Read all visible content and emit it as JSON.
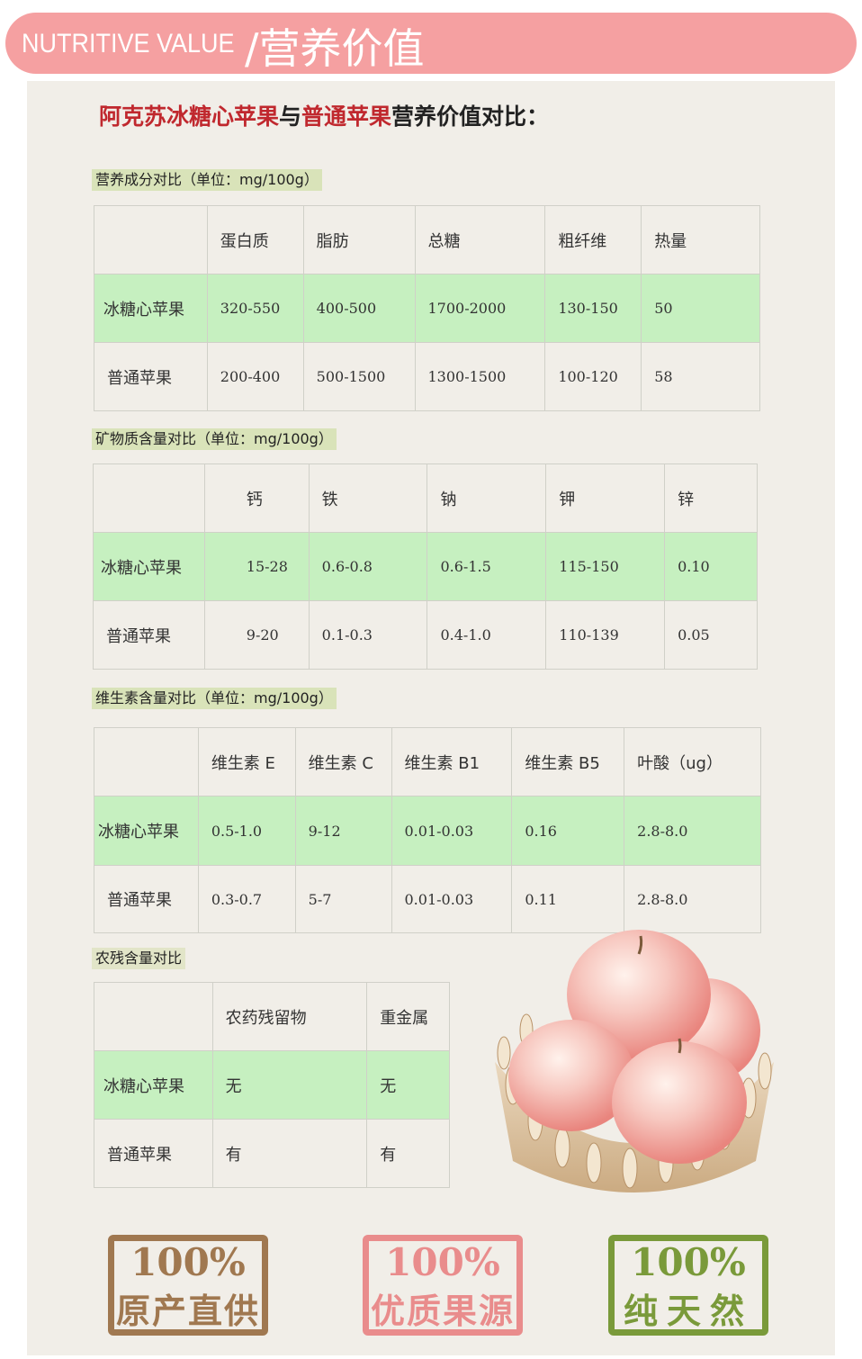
{
  "banner": {
    "en": "NUTRITIVE VALUE",
    "cn": "/营养价值"
  },
  "headline": {
    "part1": "阿克苏冰糖心苹果",
    "part2": "与",
    "part3": "普通苹果",
    "part4": "营养价值对比："
  },
  "colors": {
    "banner": "#f5a0a1",
    "highlight_row": "#c6f0c0",
    "label_bg": "#d9e3b9",
    "accent_red": "#c0282e"
  },
  "sections": [
    {
      "label": "营养成分对比（单位：mg/100g）",
      "headers": [
        "",
        "蛋白质",
        "脂肪",
        "总糖",
        "粗纤维",
        "热量"
      ],
      "rows": [
        [
          "冰糖心苹果",
          "320-550",
          "400-500",
          "1700-2000",
          "130-150",
          "50"
        ],
        [
          "普通苹果",
          "200-400",
          "500-1500",
          "1300-1500",
          "100-120",
          "58"
        ]
      ]
    },
    {
      "label": "矿物质含量对比（单位：mg/100g）",
      "headers": [
        "",
        "钙",
        "铁",
        "钠",
        "钾",
        "锌"
      ],
      "rows": [
        [
          "冰糖心苹果",
          "15-28",
          "0.6-0.8",
          "0.6-1.5",
          "115-150",
          "0.10"
        ],
        [
          "普通苹果",
          "9-20",
          "0.1-0.3",
          "0.4-1.0",
          "110-139",
          "0.05"
        ]
      ]
    },
    {
      "label": "维生素含量对比（单位：mg/100g）",
      "headers": [
        "",
        "维生素 E",
        "维生素 C",
        "维生素 B1",
        "维生素 B5",
        "叶酸（ug）"
      ],
      "rows": [
        [
          "冰糖心苹果",
          "0.5-1.0",
          "9-12",
          "0.01-0.03",
          "0.16",
          "2.8-8.0"
        ],
        [
          "普通苹果",
          "0.3-0.7",
          "5-7",
          "0.01-0.03",
          "0.11",
          "2.8-8.0"
        ]
      ]
    },
    {
      "label": "农残含量对比",
      "headers": [
        "",
        "农药残留物",
        "重金属"
      ],
      "rows": [
        [
          "冰糖心苹果",
          "无",
          "无"
        ],
        [
          "普通苹果",
          "有",
          "有"
        ]
      ]
    }
  ],
  "badges": [
    {
      "pct": "100%",
      "text": "原产直供",
      "color": "#a07850"
    },
    {
      "pct": "100%",
      "text": "优质果源",
      "color": "#e98c8c"
    },
    {
      "pct": "100%",
      "text": "纯天然",
      "color": "#7a9a3a"
    }
  ]
}
